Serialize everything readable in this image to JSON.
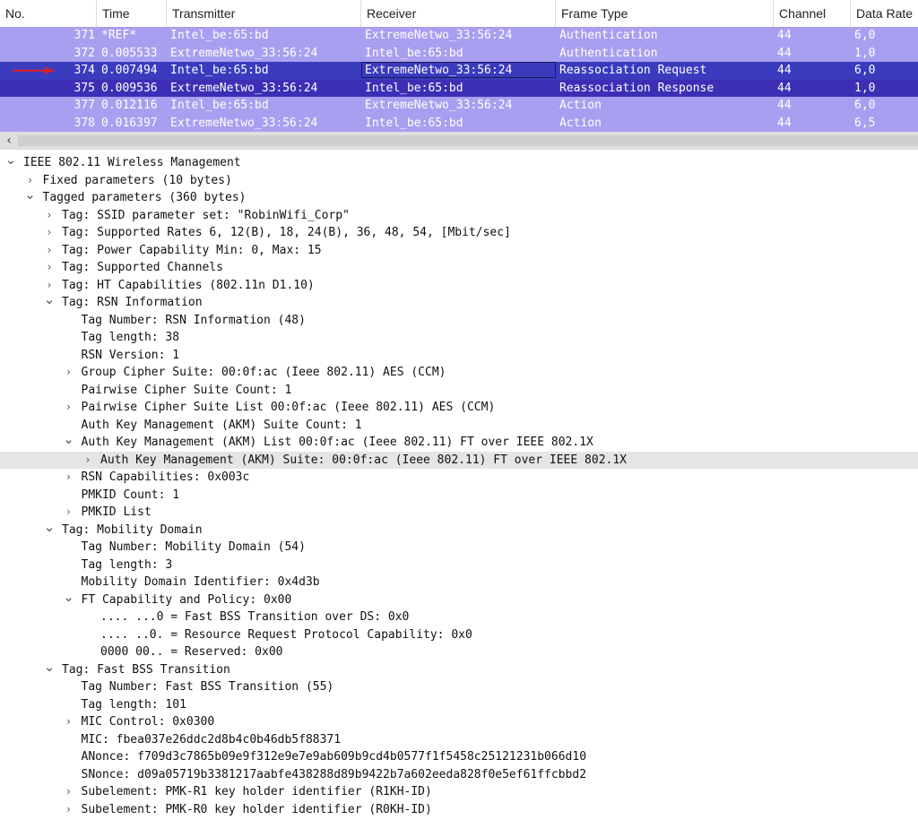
{
  "packet_list": {
    "columns": [
      "No.",
      "Time",
      "Transmitter",
      "Receiver",
      "Frame Type",
      "Channel",
      "Data Rate"
    ],
    "rows": [
      {
        "no": "371",
        "time": "*REF*",
        "tx": "Intel_be:65:bd",
        "rx": "ExtremeNetwo_33:56:24",
        "type": "Authentication",
        "ch": "44",
        "rate": "6,0"
      },
      {
        "no": "372",
        "time": "0.005533",
        "tx": "ExtremeNetwo_33:56:24",
        "rx": "Intel_be:65:bd",
        "type": "Authentication",
        "ch": "44",
        "rate": "1,0"
      },
      {
        "no": "374",
        "time": "0.007494",
        "tx": "Intel_be:65:bd",
        "rx": "ExtremeNetwo_33:56:24",
        "type": "Reassociation Request",
        "ch": "44",
        "rate": "6,0"
      },
      {
        "no": "375",
        "time": "0.009536",
        "tx": "ExtremeNetwo_33:56:24",
        "rx": "Intel_be:65:bd",
        "type": "Reassociation Response",
        "ch": "44",
        "rate": "1,0"
      },
      {
        "no": "377",
        "time": "0.012116",
        "tx": "Intel_be:65:bd",
        "rx": "ExtremeNetwo_33:56:24",
        "type": "Action",
        "ch": "44",
        "rate": "6,0"
      },
      {
        "no": "378",
        "time": "0.016397",
        "tx": "ExtremeNetwo_33:56:24",
        "rx": "Intel_be:65:bd",
        "type": "Action",
        "ch": "44",
        "rate": "6,5"
      }
    ],
    "colors": {
      "row": "#a99ff0",
      "selected": "#3a3bbd",
      "arrow": "#e02020"
    }
  },
  "scrollbar": {
    "left_icon": "chevron-left-icon"
  },
  "details": {
    "rows": [
      {
        "text": "IEEE 802.11 Wireless Management",
        "state": "expanded"
      },
      {
        "text": "Fixed parameters (10 bytes)",
        "state": "collapsed"
      },
      {
        "text": "Tagged parameters (360 bytes)",
        "state": "expanded"
      },
      {
        "text": "Tag: SSID parameter set: \"RobinWifi_Corp\"",
        "state": "collapsed"
      },
      {
        "text": "Tag: Supported Rates 6, 12(B), 18, 24(B), 36, 48, 54, [Mbit/sec]",
        "state": "collapsed"
      },
      {
        "text": "Tag: Power Capability Min: 0, Max: 15",
        "state": "collapsed"
      },
      {
        "text": "Tag: Supported Channels",
        "state": "collapsed"
      },
      {
        "text": "Tag: HT Capabilities (802.11n D1.10)",
        "state": "collapsed"
      },
      {
        "text": "Tag: RSN Information",
        "state": "expanded"
      },
      {
        "text": "Tag Number: RSN Information (48)",
        "state": "leaf"
      },
      {
        "text": "Tag length: 38",
        "state": "leaf"
      },
      {
        "text": "RSN Version: 1",
        "state": "leaf"
      },
      {
        "text": "Group Cipher Suite: 00:0f:ac (Ieee 802.11) AES (CCM)",
        "state": "collapsed"
      },
      {
        "text": "Pairwise Cipher Suite Count: 1",
        "state": "leaf"
      },
      {
        "text": "Pairwise Cipher Suite List 00:0f:ac (Ieee 802.11) AES (CCM)",
        "state": "collapsed"
      },
      {
        "text": "Auth Key Management (AKM) Suite Count: 1",
        "state": "leaf"
      },
      {
        "text": "Auth Key Management (AKM) List 00:0f:ac (Ieee 802.11) FT over IEEE 802.1X",
        "state": "expanded"
      },
      {
        "text": "Auth Key Management (AKM) Suite: 00:0f:ac (Ieee 802.11) FT over IEEE 802.1X",
        "state": "collapsed"
      },
      {
        "text": "RSN Capabilities: 0x003c",
        "state": "collapsed"
      },
      {
        "text": "PMKID Count: 1",
        "state": "leaf"
      },
      {
        "text": "PMKID List",
        "state": "collapsed"
      },
      {
        "text": "Tag: Mobility Domain",
        "state": "expanded"
      },
      {
        "text": "Tag Number: Mobility Domain (54)",
        "state": "leaf"
      },
      {
        "text": "Tag length: 3",
        "state": "leaf"
      },
      {
        "text": "Mobility Domain Identifier: 0x4d3b",
        "state": "leaf"
      },
      {
        "text": "FT Capability and Policy: 0x00",
        "state": "expanded"
      },
      {
        "text": ".... ...0 = Fast BSS Transition over DS: 0x0",
        "state": "leaf"
      },
      {
        "text": ".... ..0. = Resource Request Protocol Capability: 0x0",
        "state": "leaf"
      },
      {
        "text": "0000 00.. = Reserved: 0x00",
        "state": "leaf"
      },
      {
        "text": "Tag: Fast BSS Transition",
        "state": "expanded"
      },
      {
        "text": "Tag Number: Fast BSS Transition (55)",
        "state": "leaf"
      },
      {
        "text": "Tag length: 101",
        "state": "leaf"
      },
      {
        "text": "MIC Control: 0x0300",
        "state": "collapsed"
      },
      {
        "text": "MIC: fbea037e26ddc2d8b4c0b46db5f88371",
        "state": "leaf"
      },
      {
        "text": "ANonce: f709d3c7865b09e9f312e9e7e9ab609b9cd4b0577f1f5458c25121231b066d10",
        "state": "leaf"
      },
      {
        "text": "SNonce: d09a05719b3381217aabfe438288d89b9422b7a602eeda828f0e5ef61ffcbbd2",
        "state": "leaf"
      },
      {
        "text": "Subelement: PMK-R1 key holder identifier (R1KH-ID)",
        "state": "collapsed"
      },
      {
        "text": "Subelement: PMK-R0 key holder identifier (R0KH-ID)",
        "state": "collapsed"
      }
    ]
  }
}
